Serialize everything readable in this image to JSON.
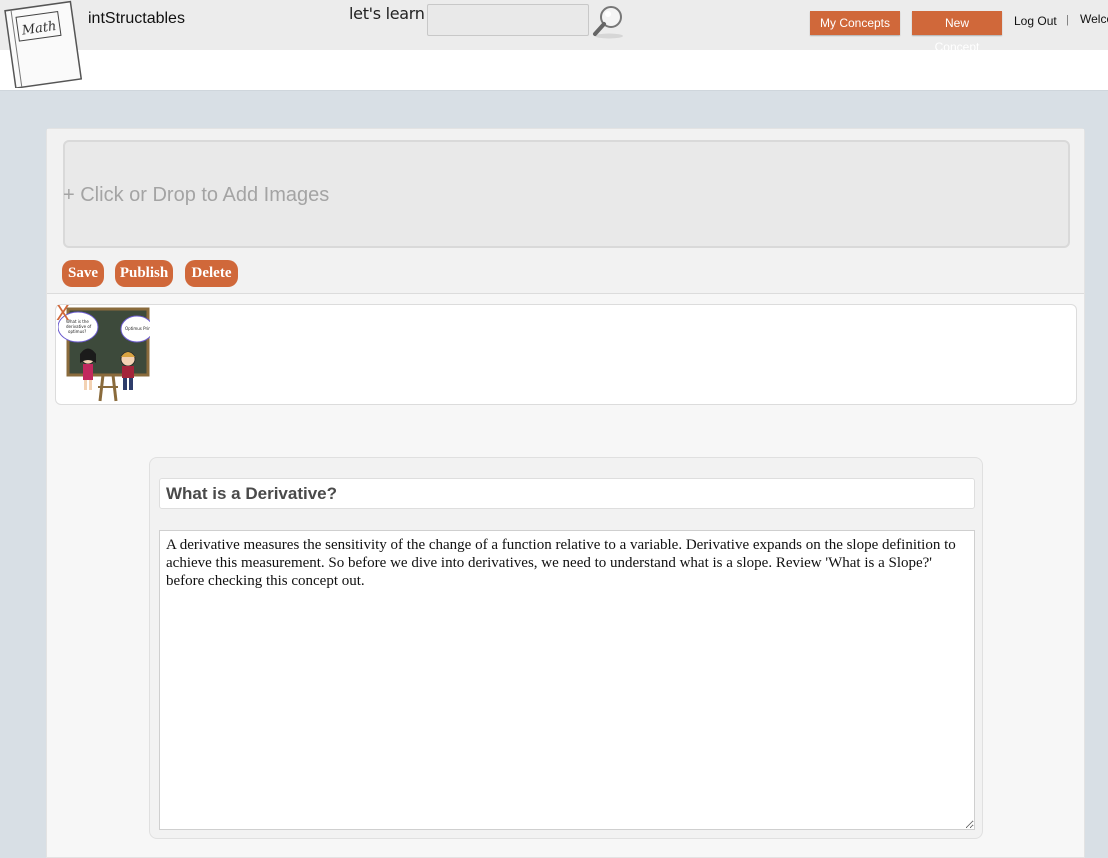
{
  "header": {
    "brand": "intStructables",
    "logo_text": "Math",
    "tagline": "let's learn",
    "search": {
      "value": "",
      "placeholder": ""
    },
    "my_concepts_label": "My Concepts",
    "new_concept_label": "New Concept",
    "logout_label": "Log Out",
    "separator": "|",
    "welcome_text": "Welco"
  },
  "editor": {
    "dropzone_label": "+ Click or Drop to Add Images",
    "save_label": "Save",
    "publish_label": "Publish",
    "delete_label": "Delete",
    "images": [
      {
        "remove_label": "X",
        "bubble_left": "What is the derivative of optimus?",
        "bubble_right": "Optimus Prime!"
      }
    ],
    "title_value": "What is a Derivative?",
    "body_value": "A derivative measures the sensitivity of the change of a function relative to a variable. Derivative expands on the slope definition to achieve this measurement. So before we dive into derivatives, we need to understand what is a slope. Review 'What is a Slope?' before checking this concept out."
  },
  "colors": {
    "accent": "#d0683a",
    "page_bg": "#d8dfe5",
    "header_bg": "#ececec"
  }
}
